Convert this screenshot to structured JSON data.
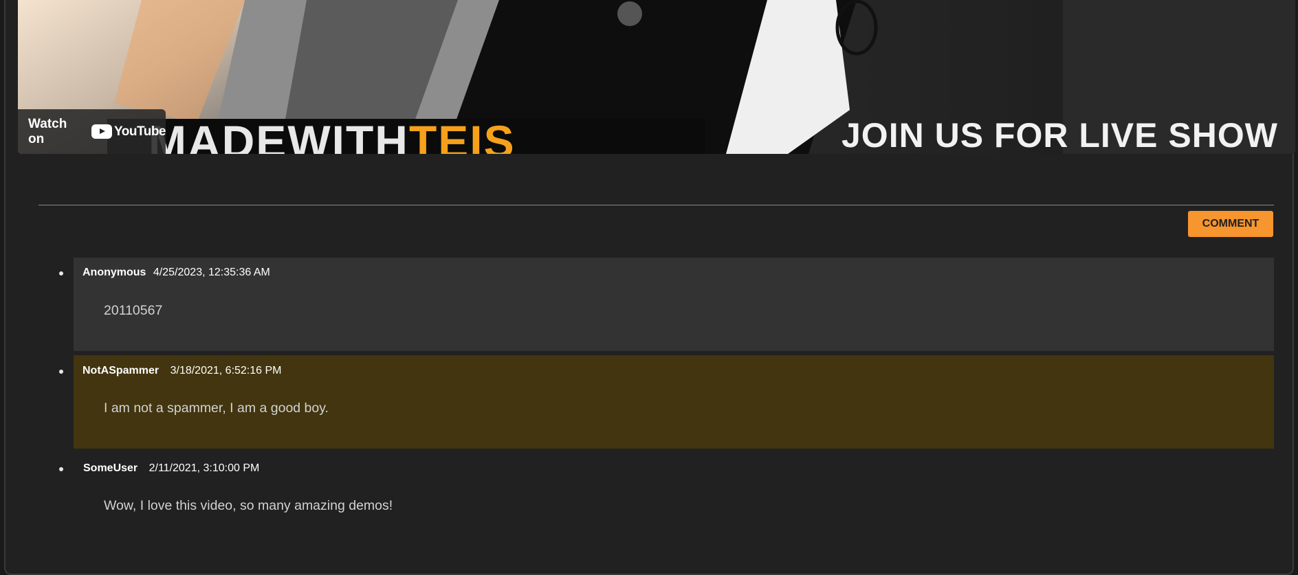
{
  "video": {
    "watch_on_label": "Watch on",
    "youtube_label": "YouTube",
    "banner_left_pre": "MADEWITH",
    "banner_left_accent": "TEIS",
    "banner_right": "JOIN US FOR LIVE SHOW"
  },
  "actions": {
    "comment_label": "COMMENT"
  },
  "comments": [
    {
      "author": "Anonymous",
      "timestamp": "4/25/2023, 12:35:36 AM",
      "text": "20110567",
      "highlighted": false,
      "bg": "#333333"
    },
    {
      "author": "NotASpammer",
      "timestamp": "3/18/2021, 6:52:16 PM",
      "text": "I am not a spammer, I am a good boy.",
      "highlighted": true,
      "bg": "#42350f"
    },
    {
      "author": "SomeUser",
      "timestamp": "2/11/2021, 3:10:00 PM",
      "text": "Wow, I love this video, so many amazing demos!",
      "highlighted": false,
      "bg": "transparent"
    }
  ],
  "colors": {
    "accent": "#f7952e",
    "panel": "#212121",
    "highlight": "#42350f"
  }
}
